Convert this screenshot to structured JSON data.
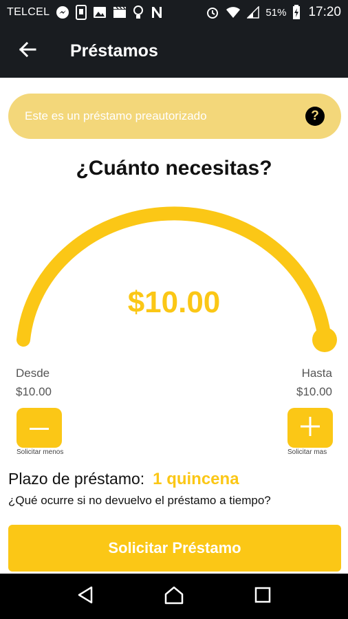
{
  "status_bar": {
    "carrier": "TELCEL",
    "battery": "51%",
    "time": "17:20",
    "icons": [
      "messenger-icon",
      "phone-icon",
      "image-icon",
      "clapper-icon",
      "bulb-icon",
      "n-icon",
      "alarm-icon",
      "wifi-icon",
      "signal-icon",
      "battery-icon"
    ]
  },
  "app_bar": {
    "title": "Préstamos"
  },
  "notice": {
    "text": "Este es un préstamo preautorizado",
    "help": "?"
  },
  "question": "¿Cuánto necesitas?",
  "gauge": {
    "amount": "$10.00",
    "level": 1.0
  },
  "range": {
    "from_label": "Desde",
    "from_value": "$10.00",
    "to_label": "Hasta",
    "to_value": "$10.00"
  },
  "stepper": {
    "minus_caption": "Solicitar menos",
    "plus_caption": "Solicitar mas"
  },
  "plazo": {
    "label": "Plazo de préstamo:",
    "value": "1 quincena",
    "late_question": "¿Qué ocurre si no devuelvo el préstamo a tiempo?"
  },
  "cta": {
    "label": "Solicitar Préstamo"
  },
  "colors": {
    "accent": "#fbc716",
    "notice_bg": "#f3d77a",
    "bar_bg": "#191c20"
  }
}
